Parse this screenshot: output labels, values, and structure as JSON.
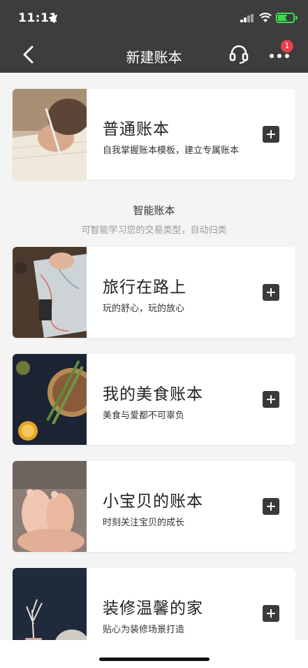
{
  "status_bar": {
    "time": "11:11",
    "icons": [
      "location-arrow-icon",
      "signal-icon",
      "wifi-icon",
      "battery-charging-icon"
    ]
  },
  "nav": {
    "title": "新建账本",
    "back_icon": "chevron-left-icon",
    "service_icon": "headset-icon",
    "more_icon": "ellipsis-icon",
    "badge_count": "1"
  },
  "basic_book": {
    "title": "普通账本",
    "subtitle": "自我掌握账本模板，建立专属账本"
  },
  "smart_section": {
    "title": "智能账本",
    "subtitle": "可智能学习您的交易类型，自动归类"
  },
  "templates": [
    {
      "title": "旅行在路上",
      "subtitle": "玩的舒心，玩的放心"
    },
    {
      "title": "我的美食账本",
      "subtitle": "美食与爱都不可辜负"
    },
    {
      "title": "小宝贝的账本",
      "subtitle": "时刻关注宝贝的成长"
    },
    {
      "title": "装修温馨的家",
      "subtitle": "贴心为装修场景打造"
    }
  ],
  "colors": {
    "bar": "#3d3d3d",
    "badge": "#e8414e",
    "plus_button": "#3a3a3a",
    "background": "#f4f4f4"
  }
}
